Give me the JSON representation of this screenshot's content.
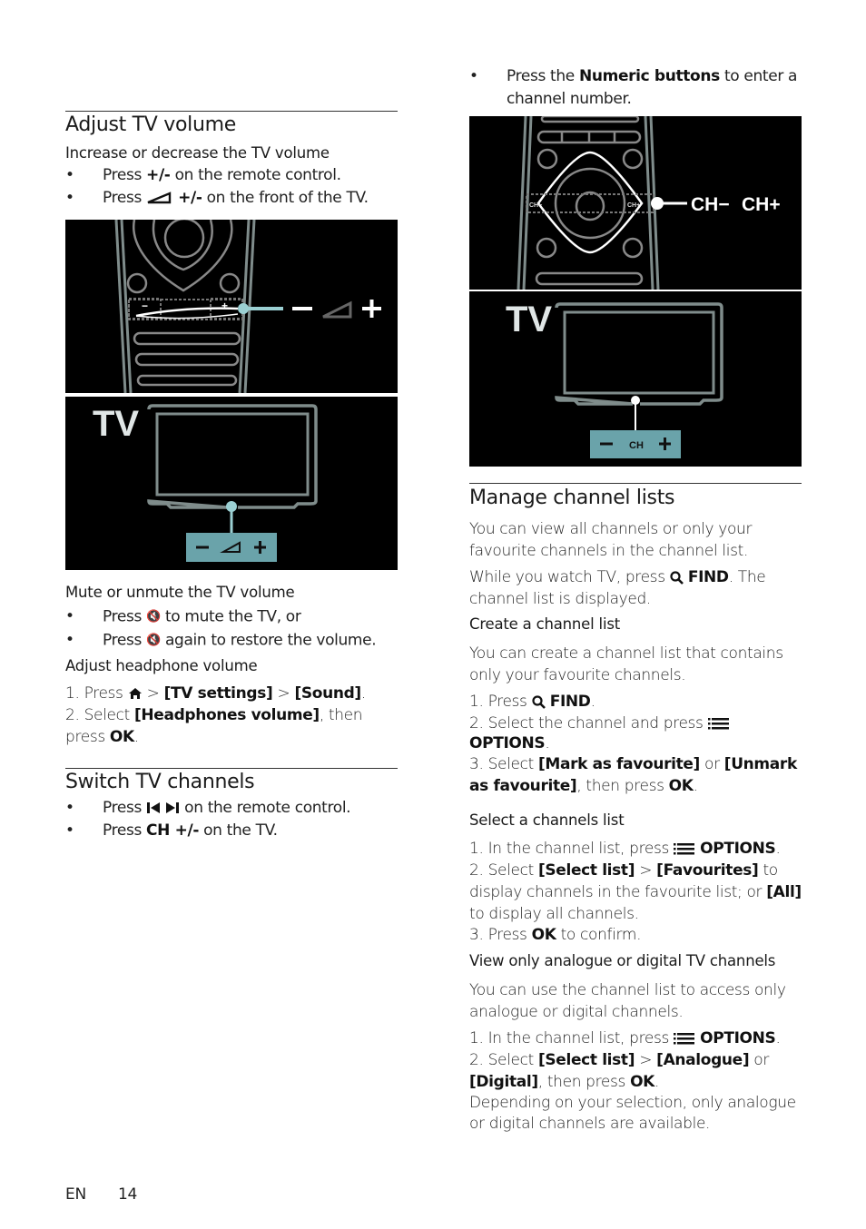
{
  "left": {
    "adjust_volume": {
      "title": "Adjust TV volume",
      "subtitle": "Increase or decrease the TV volume",
      "bullets": [
        {
          "pre": "Press ",
          "bold": "+/-",
          "post": " on the remote control."
        },
        {
          "pre": "Press ",
          "bold": "+/-",
          "post": " on the front of the TV."
        }
      ]
    },
    "figure_volume": {
      "remote_labels": {
        "minus": "−",
        "plus": "+"
      },
      "callout": {
        "minus": "−",
        "plus": "+"
      },
      "tv_label": "TV",
      "tv_panel": {
        "minus": "−",
        "plus": "+"
      }
    },
    "mute": {
      "subtitle": "Mute or unmute the TV volume",
      "bullets": [
        {
          "pre": "Press ",
          "post": " to mute the TV, or"
        },
        {
          "pre": "Press ",
          "post": " again to restore the volume."
        }
      ]
    },
    "headphone": {
      "subtitle": "Adjust headphone volume",
      "step1": {
        "pre": "1. Press ",
        "sep1": " > ",
        "b1": "[TV settings]",
        "sep2": " > ",
        "b2": "[Sound]",
        "post": "."
      },
      "step2": {
        "pre": "2. Select ",
        "b1": "[Headphones volume]",
        "mid": ", then press ",
        "b2": "OK",
        "post": "."
      }
    },
    "switch": {
      "title": "Switch TV channels",
      "bullets": [
        {
          "pre": "Press ",
          "post": " on the remote control."
        },
        {
          "pre": "Press ",
          "bold": "CH +/-",
          "post": " on the TV."
        }
      ]
    }
  },
  "right": {
    "numeric_bullet": {
      "pre": "Press the ",
      "bold": "Numeric buttons",
      "post": " to enter a channel number."
    },
    "figure_channels": {
      "remote_labels": {
        "prev": "CH−",
        "next": "CH+"
      },
      "callout": {
        "minus": "CH−",
        "plus": "CH+"
      },
      "tv_label": "TV",
      "tv_panel": {
        "minus": "−",
        "center": "CH",
        "plus": "+"
      }
    },
    "manage": {
      "title": "Manage channel lists",
      "intro": "You can view all channels or only your favourite channels in the channel list.",
      "find": {
        "pre": "While you watch TV, press ",
        "bold": "FIND",
        "post": ". The channel list is displayed."
      }
    },
    "create": {
      "subtitle": "Create a channel list",
      "intro": "You can create a channel list that contains only your favourite channels.",
      "step1": {
        "pre": "1. Press ",
        "bold": "FIND",
        "post": "."
      },
      "step2": {
        "pre": "2. Select the channel and press ",
        "bold": "OPTIONS",
        "post": "."
      },
      "step3": {
        "pre": "3. Select ",
        "b1": "[Mark as favourite]",
        "mid": " or ",
        "b2": "[Unmark as favourite]",
        "mid2": ", then press ",
        "b3": "OK",
        "post": "."
      }
    },
    "select": {
      "subtitle": "Select a channels list",
      "step1": {
        "pre": "1. In the channel list, press ",
        "bold": "OPTIONS",
        "post": "."
      },
      "step2": {
        "pre": "2. Select ",
        "b1": "[Select list]",
        "sep": " > ",
        "b2": "[Favourites]",
        "mid": " to display channels in the favourite list; or ",
        "b3": "[All]",
        "post": " to display all channels."
      },
      "step3": {
        "pre": "3. Press ",
        "bold": "OK",
        "post": " to confirm."
      }
    },
    "analogue": {
      "subtitle": "View only analogue or digital TV channels",
      "intro": "You can use the channel list to access only analogue or digital channels.",
      "step1": {
        "pre": "1. In the channel list, press ",
        "bold": "OPTIONS",
        "post": "."
      },
      "step2": {
        "pre": "2. Select ",
        "b1": "[Select list]",
        "sep": " > ",
        "b2": "[Analogue]",
        "mid": " or ",
        "b3": "[Digital]",
        "mid2": ", then press ",
        "b4": "OK",
        "post": "."
      },
      "note": "Depending on your selection, only analogue or digital channels are available."
    }
  },
  "footer": {
    "lang": "EN",
    "page": "14"
  },
  "colors": {
    "accent": "#6aa3aa",
    "figure_bg": "#000000",
    "figure_line": "#7f8c8b",
    "callout": "#9bd0d3"
  }
}
